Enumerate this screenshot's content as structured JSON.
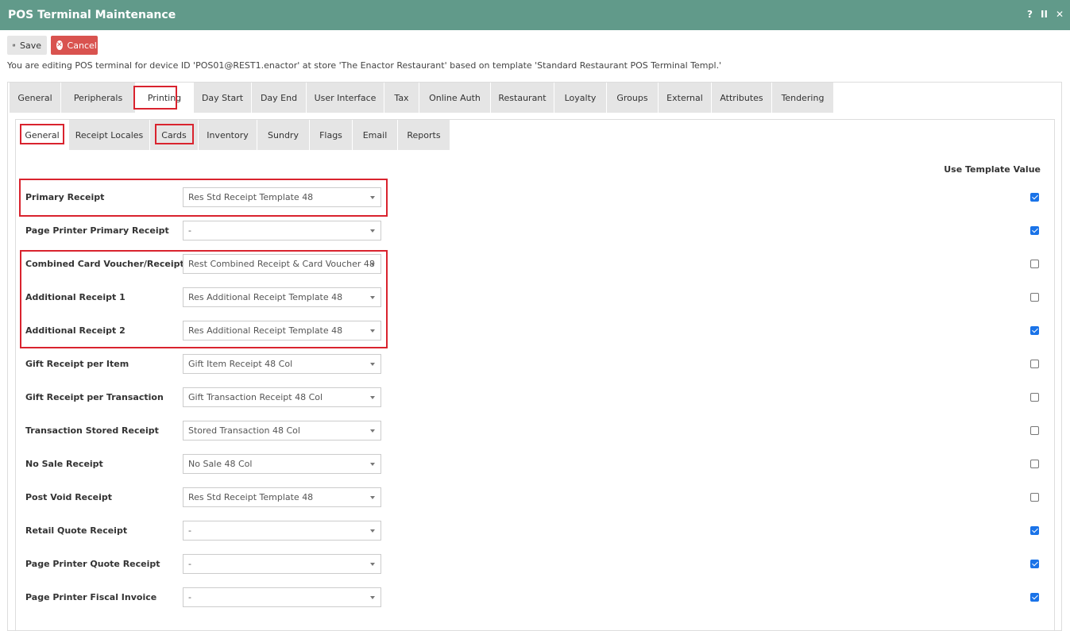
{
  "window": {
    "title": "POS Terminal Maintenance",
    "controls": [
      "?",
      "II",
      "✕"
    ]
  },
  "toolbar": {
    "save_label": "Save",
    "cancel_label": "Cancel"
  },
  "info_text": "You are editing POS terminal for device ID 'POS01@REST1.enactor' at store 'The Enactor Restaurant' based on template 'Standard Restaurant POS Terminal Templ.'",
  "main_tabs": [
    {
      "label": "General"
    },
    {
      "label": "Peripherals"
    },
    {
      "label": "Printing",
      "active": true
    },
    {
      "label": "Day Start"
    },
    {
      "label": "Day End"
    },
    {
      "label": "User Interface"
    },
    {
      "label": "Tax"
    },
    {
      "label": "Online Auth"
    },
    {
      "label": "Restaurant"
    },
    {
      "label": "Loyalty"
    },
    {
      "label": "Groups"
    },
    {
      "label": "External"
    },
    {
      "label": "Attributes"
    },
    {
      "label": "Tendering"
    }
  ],
  "sub_tabs": [
    {
      "label": "General",
      "active": true
    },
    {
      "label": "Receipt Locales"
    },
    {
      "label": "Cards"
    },
    {
      "label": "Inventory"
    },
    {
      "label": "Sundry"
    },
    {
      "label": "Flags"
    },
    {
      "label": "Email"
    },
    {
      "label": "Reports"
    }
  ],
  "column_header": "Use Template Value",
  "rows": [
    {
      "label": "Primary Receipt",
      "value": "Res Std Receipt Template 48",
      "use_template": true
    },
    {
      "label": "Page Printer Primary Receipt",
      "value": "-",
      "use_template": true
    },
    {
      "label": "Combined Card Voucher/Receipt",
      "value": "Rest Combined Receipt & Card Voucher 48",
      "use_template": false
    },
    {
      "label": "Additional Receipt 1",
      "value": "Res Additional Receipt Template 48",
      "use_template": false
    },
    {
      "label": "Additional Receipt 2",
      "value": "Res Additional Receipt Template 48",
      "use_template": true
    },
    {
      "label": "Gift Receipt per Item",
      "value": "Gift Item Receipt 48 Col",
      "use_template": false
    },
    {
      "label": "Gift Receipt per Transaction",
      "value": "Gift Transaction Receipt 48 Col",
      "use_template": false
    },
    {
      "label": "Transaction Stored Receipt",
      "value": "Stored Transaction 48 Col",
      "use_template": false
    },
    {
      "label": "No Sale Receipt",
      "value": "No Sale 48 Col",
      "use_template": false
    },
    {
      "label": "Post Void Receipt",
      "value": "Res Std Receipt Template 48",
      "use_template": false
    },
    {
      "label": "Retail Quote Receipt",
      "value": "-",
      "use_template": true
    },
    {
      "label": "Page Printer Quote Receipt",
      "value": "-",
      "use_template": true
    },
    {
      "label": "Page Printer Fiscal Invoice",
      "value": "-",
      "use_template": true
    }
  ],
  "colors": {
    "title_bar": "#619a8a",
    "cancel_button": "#d9534f",
    "highlight": "#d9232e",
    "checkbox_checked": "#1a73e8"
  },
  "icons": {
    "save": "floppy-disk-icon",
    "cancel": "cancel-circle-icon"
  }
}
